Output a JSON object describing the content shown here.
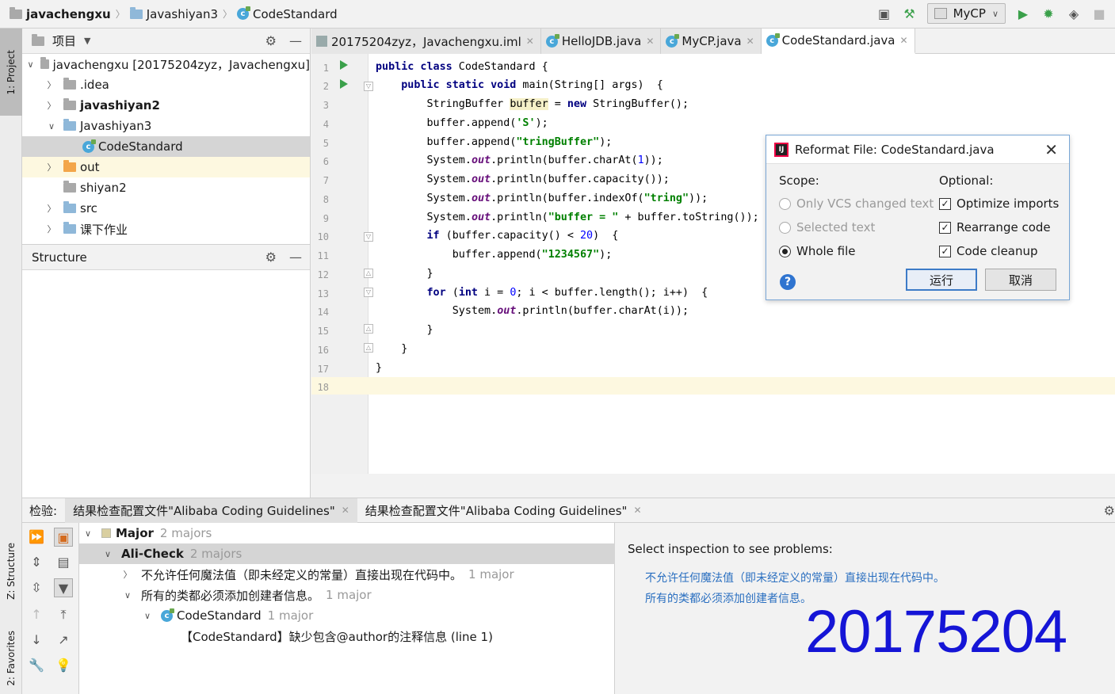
{
  "navbar": {
    "crumbs": [
      "javachengxu",
      "Javashiyan3",
      "CodeStandard"
    ],
    "run_config": "MyCP"
  },
  "left_strip": {
    "tabs": [
      "1: Project",
      "Z: Structure",
      "2: Favorites"
    ]
  },
  "project_panel": {
    "title": "项目",
    "items": [
      {
        "label": "javachengxu [20175204zyz，Javachengxu]",
        "indent": 0,
        "arrow": "down",
        "icon": "folder-gray"
      },
      {
        "label": ".idea",
        "indent": 1,
        "arrow": "right",
        "icon": "folder-gray"
      },
      {
        "label": "javashiyan2",
        "indent": 1,
        "arrow": "right",
        "icon": "folder-gray",
        "bold": true
      },
      {
        "label": "Javashiyan3",
        "indent": 1,
        "arrow": "down",
        "icon": "folder-blue"
      },
      {
        "label": "CodeStandard",
        "indent": 2,
        "arrow": "",
        "icon": "class",
        "selected": true
      },
      {
        "label": "out",
        "indent": 1,
        "arrow": "right",
        "icon": "folder-orange",
        "highlight": true
      },
      {
        "label": "shiyan2",
        "indent": 1,
        "arrow": "",
        "icon": "folder-gray"
      },
      {
        "label": "src",
        "indent": 1,
        "arrow": "right",
        "icon": "folder-blue"
      },
      {
        "label": "课下作业",
        "indent": 1,
        "arrow": "right",
        "icon": "folder-blue"
      }
    ]
  },
  "structure_panel": {
    "title": "Structure"
  },
  "editor_tabs": [
    {
      "label": "20175204zyz，Javachengxu.iml",
      "active": false,
      "icon": "module-icon"
    },
    {
      "label": "HelloJDB.java",
      "active": false,
      "icon": "class-icon"
    },
    {
      "label": "MyCP.java",
      "active": false,
      "icon": "class-icon"
    },
    {
      "label": "CodeStandard.java",
      "active": true,
      "icon": "class-icon"
    }
  ],
  "editor": {
    "line_numbers": [
      "1",
      "2",
      "3",
      "4",
      "5",
      "6",
      "7",
      "8",
      "9",
      "10",
      "11",
      "12",
      "13",
      "14",
      "15",
      "16",
      "17",
      "18"
    ]
  },
  "dialog": {
    "title": "Reformat File: CodeStandard.java",
    "scope_label": "Scope:",
    "optional_label": "Optional:",
    "scope_options": [
      {
        "label": "Only VCS changed text",
        "checked": false,
        "disabled": true
      },
      {
        "label": "Selected text",
        "checked": false,
        "disabled": true
      },
      {
        "label": "Whole file",
        "checked": true,
        "disabled": false
      }
    ],
    "optional_options": [
      {
        "label": "Optimize imports",
        "checked": true
      },
      {
        "label": "Rearrange code",
        "checked": true
      },
      {
        "label": "Code cleanup",
        "checked": true
      }
    ],
    "run_button": "运行",
    "cancel_button": "取消"
  },
  "bottom": {
    "prefix": "检验:",
    "tabs": [
      {
        "label": "结果检查配置文件\"Alibaba Coding Guidelines\"",
        "active": true
      },
      {
        "label": "结果检查配置文件\"Alibaba Coding Guidelines\"",
        "active": false
      }
    ],
    "tree": [
      {
        "label": "Major",
        "meta": "2 majors",
        "indent": 0,
        "arrow": "down",
        "bold": true,
        "sev": true
      },
      {
        "label": "Ali-Check",
        "meta": "2 majors",
        "indent": 1,
        "arrow": "down",
        "bold": true,
        "selected": true
      },
      {
        "label": "不允许任何魔法值（即未经定义的常量）直接出现在代码中。",
        "meta": "1 major",
        "indent": 2,
        "arrow": "right"
      },
      {
        "label": "所有的类都必须添加创建者信息。",
        "meta": "1 major",
        "indent": 2,
        "arrow": "down"
      },
      {
        "label": "CodeStandard",
        "meta": "1 major",
        "indent": 3,
        "arrow": "down",
        "class": true
      },
      {
        "label": "【CodeStandard】缺少包含@author的注释信息 (line 1)",
        "meta": "",
        "indent": 4,
        "arrow": ""
      }
    ],
    "right_title": "Select inspection to see problems:",
    "right_links": [
      "不允许任何魔法值（即未经定义的常量）直接出现在代码中。",
      "所有的类都必须添加创建者信息。"
    ],
    "big_number": "20175204"
  }
}
